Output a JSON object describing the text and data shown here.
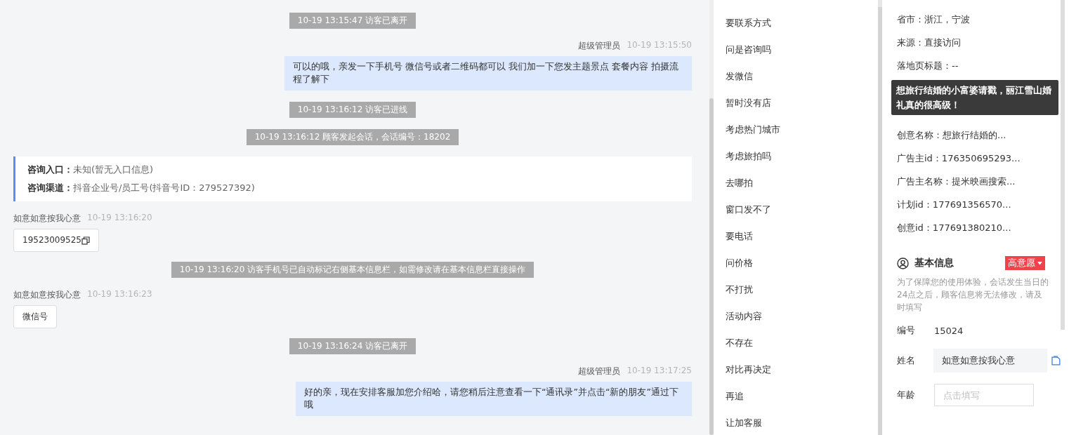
{
  "chat": {
    "messages": [
      {
        "kind": "system",
        "text": "10-19 13:15:47 访客已离开"
      },
      {
        "kind": "outgoing",
        "sender": "超级管理员",
        "time": "10-19 13:15:50",
        "text": "可以的哦，亲发一下手机号 微信号或者二维码都可以 我们加一下您发主题景点 套餐内容 拍摄流程了解下"
      },
      {
        "kind": "system",
        "text": "10-19 13:16:12 访客已进线"
      },
      {
        "kind": "system",
        "text": "10-19 13:16:12 顾客发起会话，会话编号：18202"
      },
      {
        "kind": "info",
        "lines": [
          {
            "label": "咨询入口：",
            "value": "未知(暂无入口信息)"
          },
          {
            "label": "咨询渠道：",
            "value": "抖音企业号/员工号(抖音号ID：279527392)"
          }
        ]
      },
      {
        "kind": "incoming",
        "sender": "如意如意按我心意",
        "time": "10-19 13:16:20",
        "text": "19523009525",
        "copy": true
      },
      {
        "kind": "system",
        "text": "10-19 13:16:20 访客手机号已自动标记右侧基本信息栏，如需修改请在基本信息栏直接操作"
      },
      {
        "kind": "incoming",
        "sender": "如意如意按我心意",
        "time": "10-19 13:16:23",
        "text": "微信号",
        "copy": false
      },
      {
        "kind": "system",
        "text": "10-19 13:16:24 访客已离开"
      },
      {
        "kind": "outgoing",
        "sender": "超级管理员",
        "time": "10-19 13:17:25",
        "text": "好的亲，现在安排客服加您介绍哈，请您稍后注意查看一下“通讯录”并点击“新的朋友”通过下哦"
      }
    ]
  },
  "quick_replies": [
    "要联系方式",
    "问是咨询吗",
    "发微信",
    "暂时没有店",
    "考虑热门城市",
    "考虑旅拍吗",
    "去哪拍",
    "窗口发不了",
    "要电话",
    "问价格",
    "不打扰",
    "活动内容",
    "不存在",
    "对比再决定",
    "再追",
    "让加客服"
  ],
  "details": {
    "rows_before": [
      "省市：浙江，宁波",
      "来源：直接访问",
      "落地页标题：--"
    ],
    "tooltip": "想旅行结婚的小富婆请戳，丽江雪山婚礼真的很高级！",
    "rows_after": [
      "创意名称：想旅行结婚的...",
      "广告主id：176350695293...",
      "广告主名称：提米映画搜索...",
      "计划id：177691356570...",
      "创意id：177691380210..."
    ]
  },
  "basic_info": {
    "title": "基本信息",
    "tag": "高意愿",
    "notice": "为了保障您的使用体验，会话发生当日的24点之后，顾客信息将无法修改，请及时填写",
    "fields": [
      {
        "kind": "text",
        "label": "编号",
        "value": "15024"
      },
      {
        "kind": "copy",
        "label": "姓名",
        "value": "如意如意按我心意"
      },
      {
        "kind": "input",
        "label": "年龄",
        "placeholder": "点击填写"
      }
    ]
  }
}
